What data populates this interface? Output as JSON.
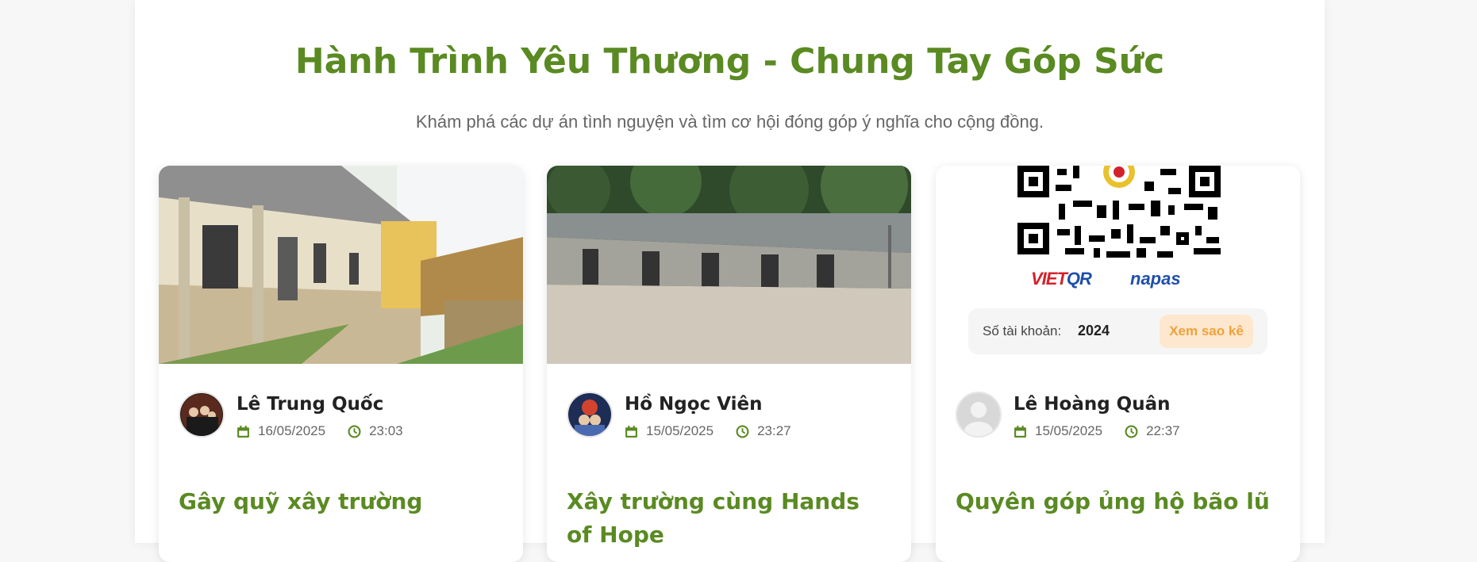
{
  "header": {
    "title": "Hành Trình Yêu Thương - Chung Tay Góp Sức",
    "subtitle": "Khám phá các dự án tình nguyện và tìm cơ hội đóng góp ý nghĩa cho cộng đồng."
  },
  "colors": {
    "accent": "#5a8a22",
    "button_bg": "#fde8cf",
    "button_text": "#f0a13a"
  },
  "cards": [
    {
      "author": "Lê Trung Quốc",
      "date": "16/05/2025",
      "time": "23:03",
      "title": "Gây quỹ xây trường",
      "image": "old-school-building-photo"
    },
    {
      "author": "Hồ Ngọc Viên",
      "date": "15/05/2025",
      "time": "23:27",
      "title": "Xây trường cùng Hands of Hope",
      "image": "rural-school-forest-photo"
    },
    {
      "author": "Lê Hoàng Quân",
      "date": "15/05/2025",
      "time": "22:37",
      "title": "Quyên góp ủng hộ bão lũ",
      "image": "qr-code-donation",
      "qr": {
        "logo_vietqr_a": "VIET",
        "logo_vietqr_b": "QR",
        "logo_napas": "napas",
        "account_label": "Số tài khoản:",
        "account_number": "2024",
        "show_more_label": "Xem sao kê"
      }
    }
  ],
  "icons": {
    "calendar": "calendar-icon",
    "clock": "clock-icon",
    "user_placeholder": "user-placeholder-icon"
  }
}
